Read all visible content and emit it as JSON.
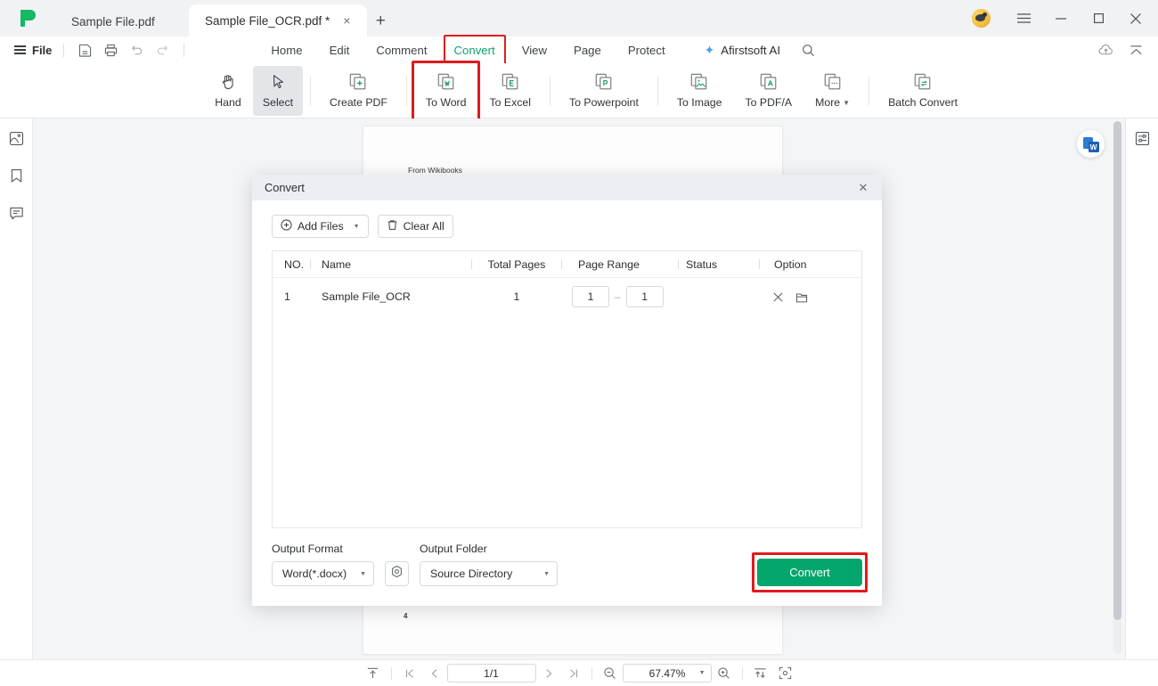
{
  "titlebar": {
    "logo_icon": "afirstsoft-logo-icon",
    "tabs": [
      {
        "label": "Sample File.pdf",
        "active": false
      },
      {
        "label": "Sample File_OCR.pdf *",
        "active": true
      }
    ],
    "new_tab_label": "+",
    "close_tab_label": "×",
    "avatar_icon": "user-avatar",
    "menu_icon": "hamburger-menu-icon",
    "minimize_label": "—",
    "maximize_label": "□",
    "close_label": "✕"
  },
  "menubar": {
    "file_label": "File",
    "quick_icons": [
      "save-icon",
      "print-icon",
      "undo-icon",
      "redo-icon"
    ],
    "tabs": [
      {
        "label": "Home",
        "active": false
      },
      {
        "label": "Edit",
        "active": false
      },
      {
        "label": "Comment",
        "active": false
      },
      {
        "label": "Convert",
        "active": true,
        "highlighted": true
      },
      {
        "label": "View",
        "active": false
      },
      {
        "label": "Page",
        "active": false
      },
      {
        "label": "Protect",
        "active": false
      }
    ],
    "ai_label": "Afirstsoft AI",
    "search_icon": "search-icon",
    "cloud_icon": "cloud-upload-icon",
    "collapse_icon": "collapse-ribbon-icon"
  },
  "toolbar": {
    "items": [
      {
        "label": "Hand",
        "icon": "hand-icon",
        "selected": false,
        "highlighted": false
      },
      {
        "label": "Select",
        "icon": "cursor-select-icon",
        "selected": true,
        "highlighted": false
      },
      {
        "label": "Create PDF",
        "icon": "create-pdf-icon",
        "selected": false,
        "highlighted": false
      },
      {
        "label": "To Word",
        "icon": "to-word-icon",
        "selected": false,
        "highlighted": true
      },
      {
        "label": "To Excel",
        "icon": "to-excel-icon",
        "selected": false,
        "highlighted": false
      },
      {
        "label": "To Powerpoint",
        "icon": "to-powerpoint-icon",
        "selected": false,
        "highlighted": false
      },
      {
        "label": "To Image",
        "icon": "to-image-icon",
        "selected": false,
        "highlighted": false
      },
      {
        "label": "To PDF/A",
        "icon": "to-pdfa-icon",
        "selected": false,
        "highlighted": false
      },
      {
        "label": "More",
        "icon": "more-icon",
        "selected": false,
        "highlighted": false,
        "caret": true
      },
      {
        "label": "Batch Convert",
        "icon": "batch-convert-icon",
        "selected": false,
        "highlighted": false
      }
    ]
  },
  "left_rail": {
    "items": [
      {
        "icon": "thumbnails-icon"
      },
      {
        "icon": "bookmark-icon"
      },
      {
        "icon": "comment-icon"
      }
    ]
  },
  "right_rail": {
    "items": [
      {
        "icon": "properties-panel-icon"
      }
    ]
  },
  "document": {
    "text_top": "From Wikibooks",
    "page_number": "4",
    "word_badge_icon": "word-convert-badge-icon",
    "word_badge_letter": "W"
  },
  "statusbar": {
    "scroll_mode_icon": "scroll-top-icon",
    "first_page_icon": "first-page-icon",
    "prev_page_icon": "prev-page-icon",
    "page_value": "1/1",
    "next_page_icon": "next-page-icon",
    "last_page_icon": "last-page-icon",
    "zoom_out_icon": "zoom-out-icon",
    "zoom_value": "67.47%",
    "zoom_in_icon": "zoom-in-icon",
    "fit_width_icon": "fit-width-icon",
    "fit_page_icon": "fit-page-icon"
  },
  "modal": {
    "title": "Convert",
    "close_label": "✕",
    "add_files_label": "Add Files",
    "add_files_icon": "plus-circle-icon",
    "clear_all_label": "Clear All",
    "clear_all_icon": "trash-icon",
    "columns": [
      "NO.",
      "Name",
      "Total Pages",
      "Page Range",
      "Status",
      "Option"
    ],
    "rows": [
      {
        "no": "1",
        "name": "Sample File_OCR",
        "total_pages": "1",
        "range_from": "1",
        "range_to": "1",
        "range_dash": "–",
        "status": "",
        "remove_icon": "remove-file-icon",
        "folder_icon": "open-folder-icon"
      }
    ],
    "output_format_label": "Output Format",
    "output_format_value": "Word(*.docx)",
    "settings_icon": "settings-gear-icon",
    "output_folder_label": "Output Folder",
    "output_folder_value": "Source Directory",
    "convert_label": "Convert"
  },
  "colors": {
    "accent_green": "#05a66b",
    "highlight_red": "#e01b1b",
    "tab_active_green": "#0fa26b",
    "logo_green": "#14b866"
  }
}
